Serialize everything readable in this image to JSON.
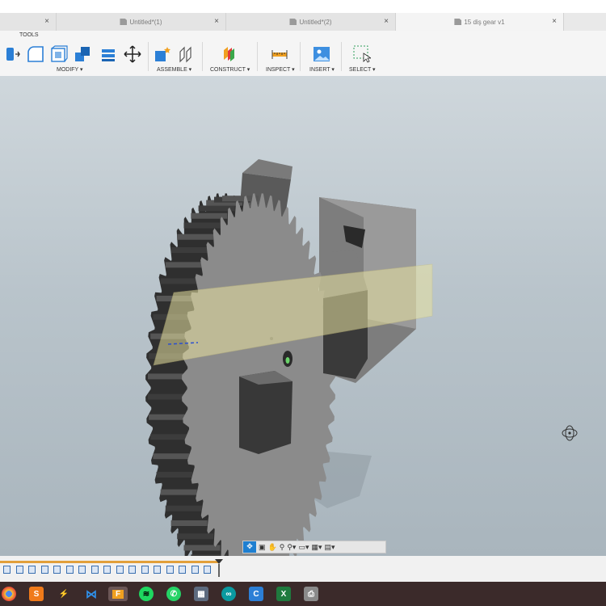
{
  "tabs": [
    {
      "label": "",
      "active": false
    },
    {
      "label": "Untitled*(1)",
      "active": false
    },
    {
      "label": "Untitled*(2)",
      "active": false
    },
    {
      "label": "15 diş gear v1",
      "active": true
    }
  ],
  "toolbar": {
    "tools_label": "TOOLS",
    "groups": {
      "modify": "MODIFY ▾",
      "assemble": "ASSEMBLE ▾",
      "construct": "CONSTRUCT ▾",
      "inspect": "INSPECT ▾",
      "insert": "INSERT ▾",
      "select": "SELECT ▾"
    }
  },
  "colors": {
    "accent": "#1e7fd1",
    "timeline_track": "#e2a03a",
    "taskbar": "#3b2a2a",
    "construction_plane": "#e8e2a0"
  },
  "navbar": {
    "items": [
      "orbit-icon",
      "look-at-icon",
      "pan-icon",
      "zoom-window-icon",
      "zoom-icon",
      "display-settings-icon",
      "grid-icon",
      "viewports-icon"
    ]
  },
  "taskbar": {
    "apps": [
      "chrome-icon",
      "sublime-icon",
      "store-icon",
      "vscode-icon",
      "fusion-icon",
      "spotify-icon",
      "whatsapp-icon",
      "calculator-icon",
      "arduino-icon",
      "ccleaner-icon",
      "excel-icon",
      "printer-icon"
    ],
    "fusion_letter": "F"
  }
}
